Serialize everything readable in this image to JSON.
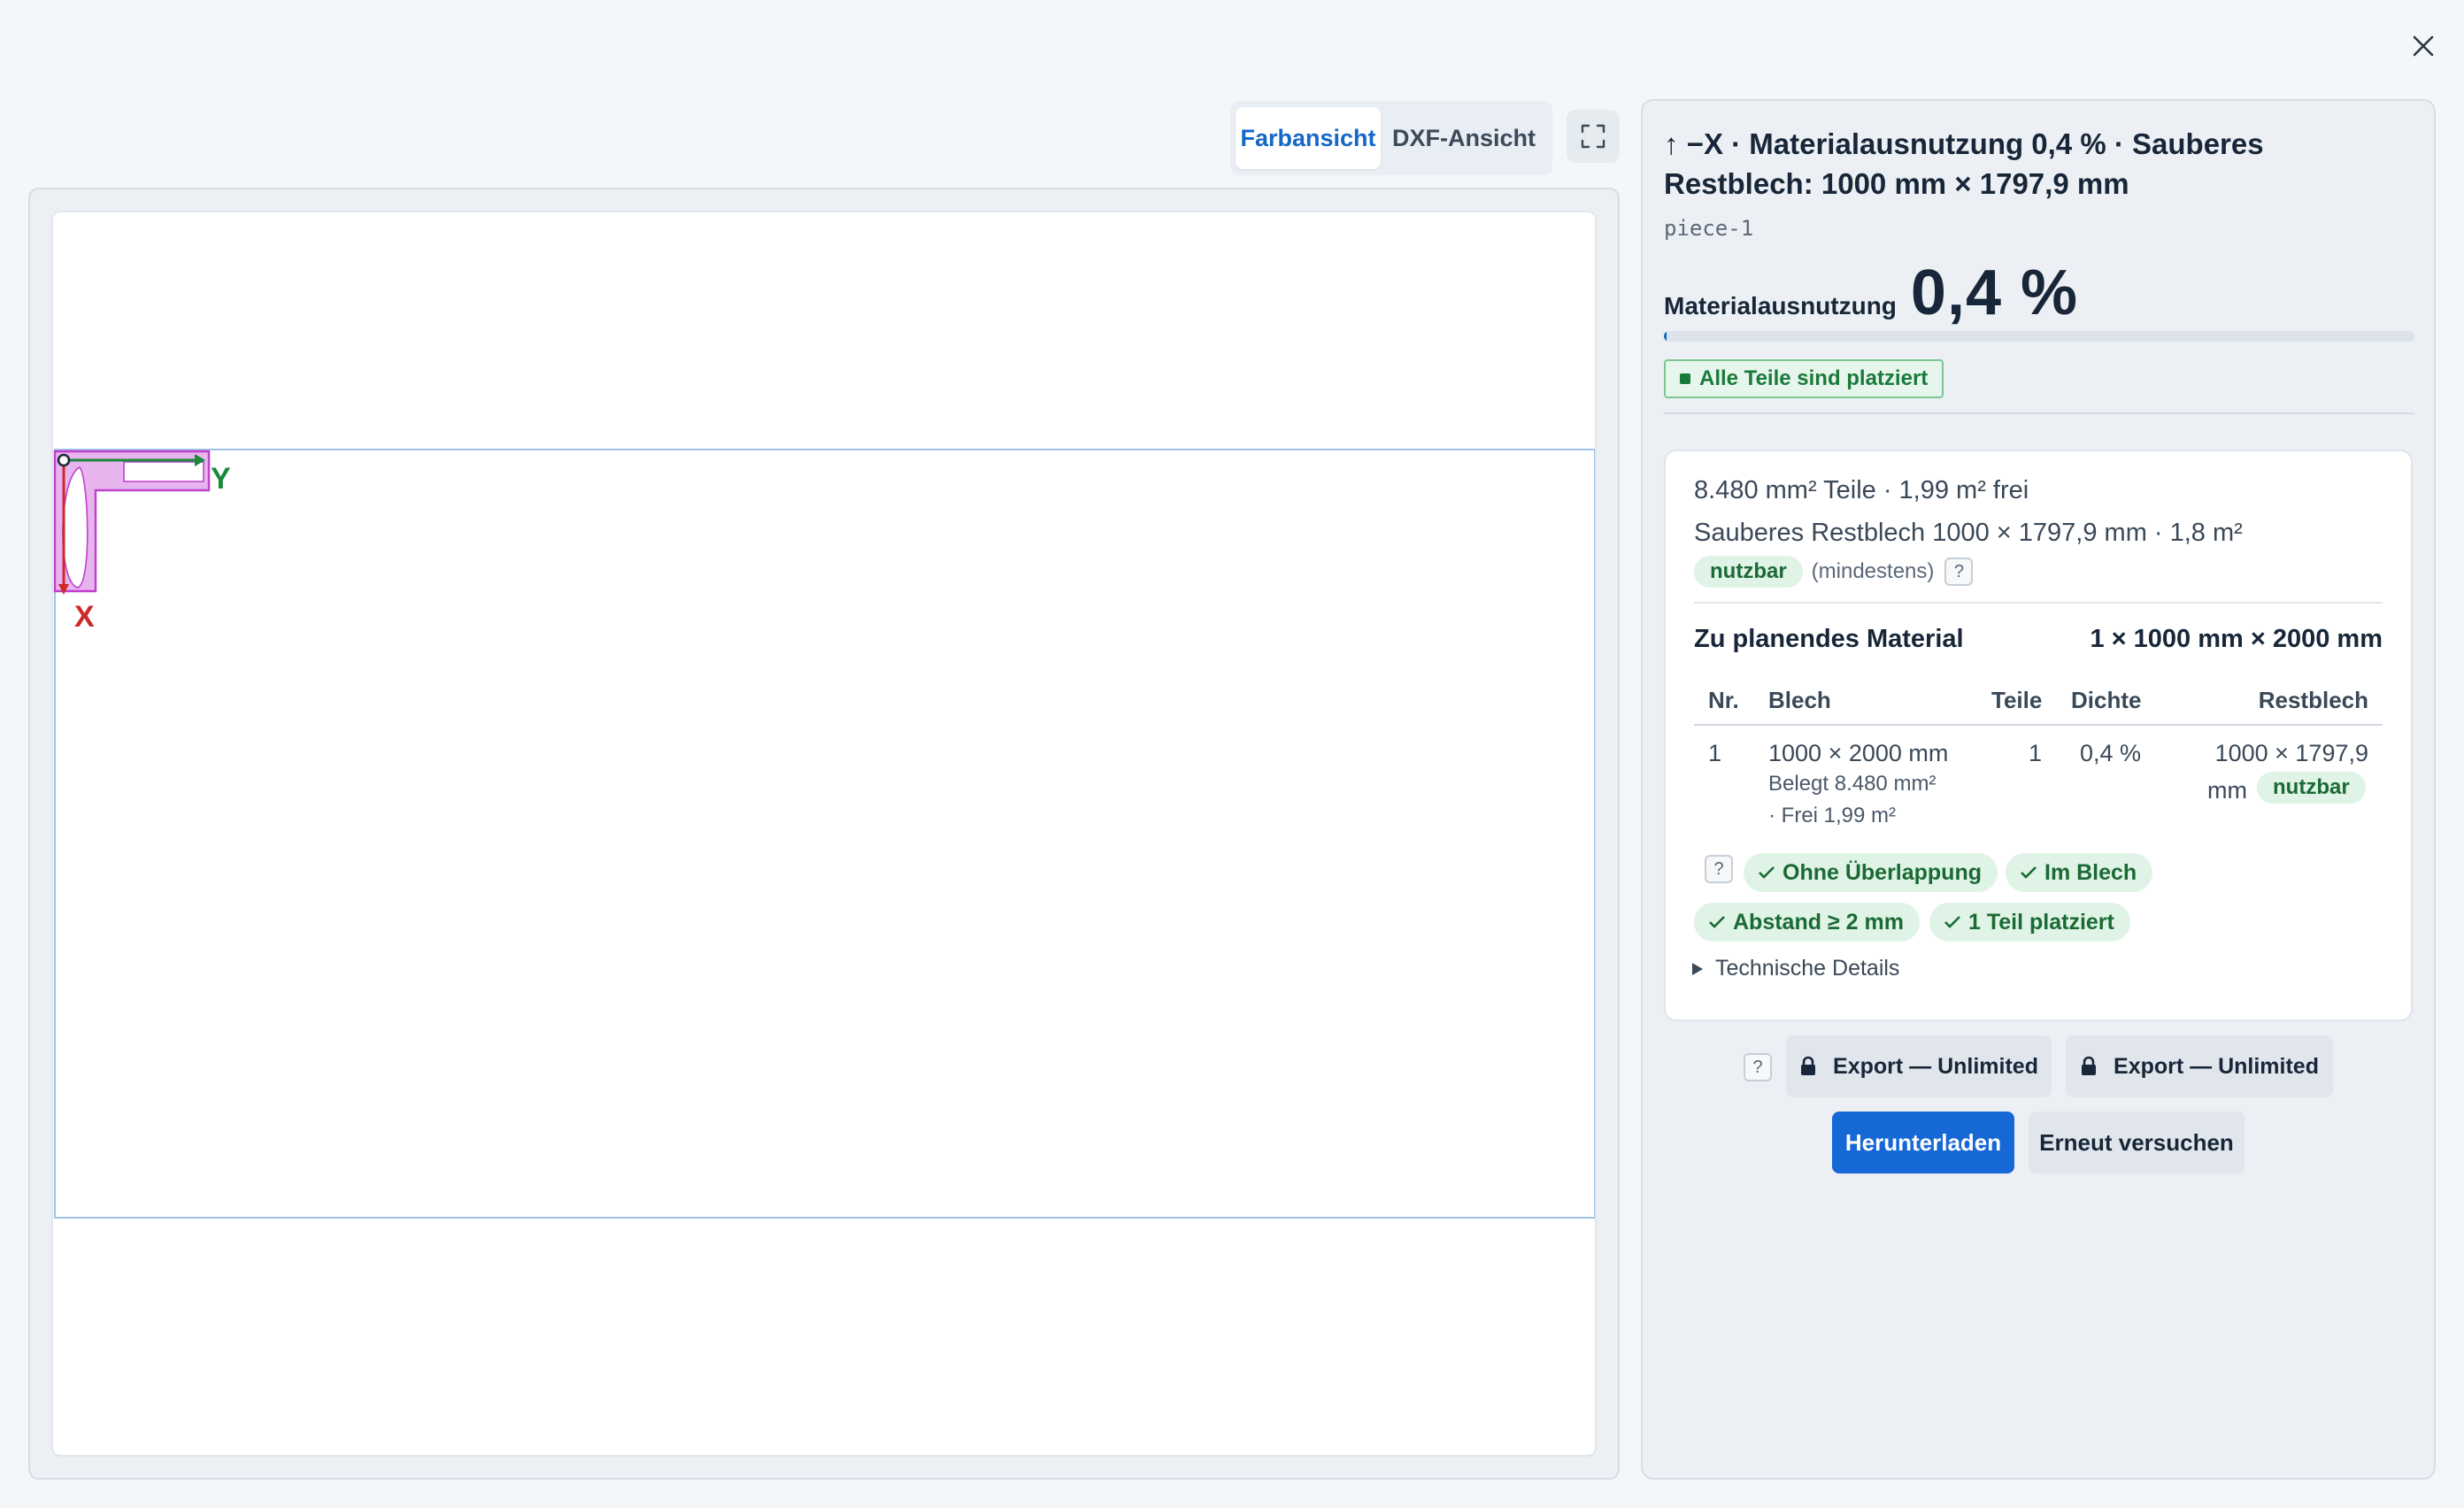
{
  "toolbar": {
    "tabs": [
      {
        "label": "Farbansicht",
        "active": true
      },
      {
        "label": "DXF-Ansicht",
        "active": false
      }
    ]
  },
  "canvas": {
    "axis_x_label": "X",
    "axis_y_label": "Y",
    "colors": {
      "sheet_outline": "#9ec3e8",
      "part_fill": "#e8b4ee",
      "part_stroke": "#c040cc",
      "axis_x": "#cc2a2a",
      "axis_y": "#1a8a3a"
    }
  },
  "panel": {
    "title": "↑ −X · Materialausnutzung 0,4 % · Sauberes Restblech: 1000 mm × 1797,9 mm",
    "piece_id": "piece-1",
    "utilization_label": "Materialausnutzung",
    "utilization_value": "0,4 %",
    "utilization_fraction": 0.004,
    "status_badge": "Alle Teile sind platziert"
  },
  "summary": {
    "line1": "8.480 mm² Teile · 1,99 m² frei",
    "line2": "Sauberes Restblech 1000 × 1797,9 mm · 1,8 m²",
    "usable": "nutzbar",
    "usable_note": "(mindestens)",
    "help": "?"
  },
  "material": {
    "label": "Zu planendes Material",
    "value": "1 × 1000 mm × 2000 mm",
    "headers": [
      "Nr.",
      "Blech",
      "Teile",
      "Dichte",
      "Restblech"
    ],
    "row": {
      "nr": "1",
      "sheet": "1000 × 2000 mm",
      "occupied": "Belegt 8.480 mm²",
      "free": "· Frei 1,99 m²",
      "parts": "1",
      "density": "0,4 %",
      "remnant_line1": "1000 × 1797,9",
      "remnant_line2": "mm",
      "remnant_badge": "nutzbar"
    }
  },
  "checks": [
    "Ohne Überlappung",
    "Im Blech",
    "Abstand ≥ 2 mm",
    "1 Teil platziert"
  ],
  "details_label": "Technische Details",
  "actions": {
    "help": "?",
    "export1": "Export — Unlimited",
    "export2": "Export — Unlimited",
    "download": "Herunterladen",
    "retry": "Erneut versuchen"
  }
}
